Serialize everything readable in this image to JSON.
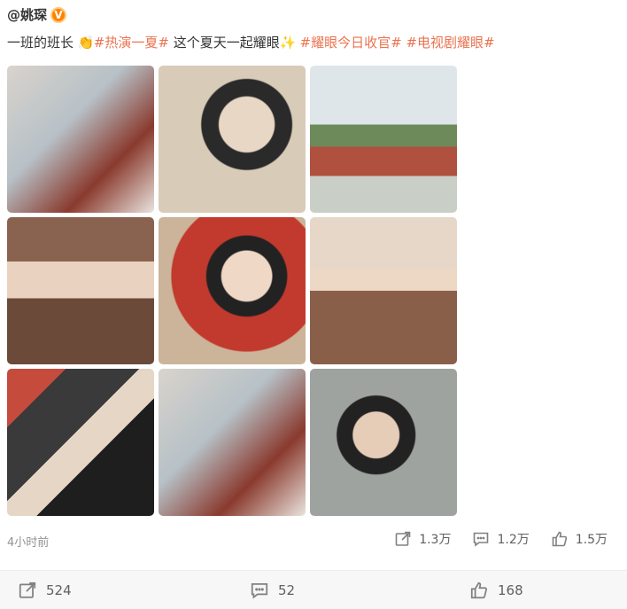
{
  "post": {
    "author": "@姚琛",
    "content": {
      "text1": "一班的班长",
      "tag1": "#热演一夏#",
      "text2": "这个夏天一起耀眼",
      "tag2": "#耀眼今日收官#",
      "tag3": "#电视剧耀眼#"
    },
    "timestamp": "4小时前",
    "stats": {
      "reposts": "1.3万",
      "comments": "1.2万",
      "likes": "1.5万"
    },
    "images": [
      "photo-1",
      "photo-2",
      "photo-3",
      "photo-4",
      "photo-5",
      "photo-6",
      "photo-7",
      "photo-8",
      "photo-9"
    ]
  },
  "bottom_bar": {
    "reposts": "524",
    "comments": "52",
    "likes": "168"
  },
  "icons": {
    "verified": "verified-badge-icon",
    "repost": "repost-icon",
    "comment": "comment-icon",
    "like": "like-icon"
  },
  "colors": {
    "hashtag": "#eb7350",
    "verified": "#ff8200"
  }
}
